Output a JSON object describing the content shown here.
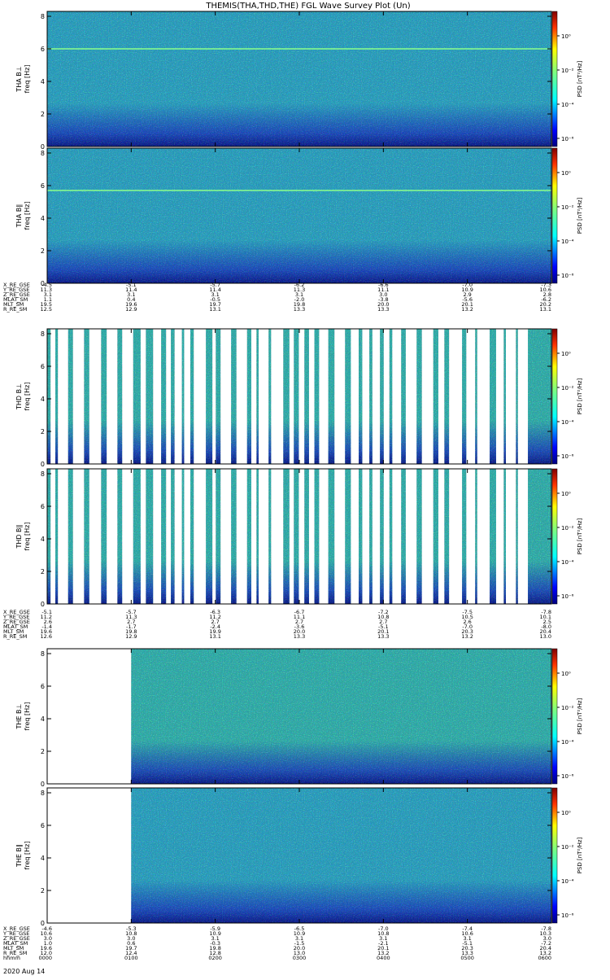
{
  "title": "THEMIS(THA,THD,THE) FGL Wave Survey Plot (Un)",
  "colorbar": {
    "tick_labels": [
      "10⁰",
      "10⁻²",
      "10⁻⁴",
      "10⁻⁶"
    ],
    "unit_label": "PSD [nT²/Hz]"
  },
  "chart_data": {
    "type": "heatmap",
    "x": {
      "tick_labels": [
        "0000",
        "0100",
        "0200",
        "0300",
        "0400",
        "0500",
        "0600"
      ],
      "unit": "hhmm",
      "date": "2020 Aug 14",
      "range_hours": [
        0,
        6
      ]
    },
    "y": {
      "label": "freq [Hz]",
      "ticks": [
        0,
        2,
        4,
        6,
        8
      ],
      "range": [
        0,
        8.3
      ]
    },
    "zscale": "log",
    "panels": [
      {
        "label": "THA B⊥",
        "coverage": [
          [
            0,
            6
          ]
        ],
        "line_hz": 6.0,
        "dominant": "mid"
      },
      {
        "label": "THA B∥",
        "coverage": [
          [
            0,
            6
          ]
        ],
        "line_hz": 5.7,
        "dominant": "mid"
      },
      {
        "label": "THD B⊥",
        "coverage": "intermittent",
        "dominant": "high"
      },
      {
        "label": "THD B∥",
        "coverage": "intermittent",
        "dominant": "high"
      },
      {
        "label": "THE B⊥",
        "coverage": [
          [
            1,
            6
          ]
        ],
        "dominant": "high"
      },
      {
        "label": "THE B∥",
        "coverage": [
          [
            1,
            6
          ]
        ],
        "dominant": "mid"
      }
    ],
    "ephemeris": [
      {
        "probe": "THA",
        "rows": [
          {
            "label": "X_RE_GSE",
            "values": [
              "-4.5",
              "-5.1",
              "-5.7",
              "-6.2",
              "-6.6",
              "-7.0",
              "-7.3"
            ]
          },
          {
            "label": "Y_RE_GSE",
            "values": [
              "11.3",
              "11.4",
              "11.4",
              "11.3",
              "11.1",
              "10.9",
              "10.6"
            ]
          },
          {
            "label": "Z_RE_GSE",
            "values": [
              "3.1",
              "3.1",
              "3.1",
              "3.1",
              "3.0",
              "2.9",
              "2.8"
            ]
          },
          {
            "label": "MLAT_SM",
            "values": [
              "1.1",
              "0.4",
              "-0.5",
              "-2.0",
              "-3.8",
              "-5.6",
              "-6.2"
            ]
          },
          {
            "label": "MLT_SM",
            "values": [
              "19.5",
              "19.6",
              "19.7",
              "19.8",
              "20.0",
              "20.1",
              "20.2"
            ]
          },
          {
            "label": "R_RE_SM",
            "values": [
              "12.5",
              "12.9",
              "13.1",
              "13.3",
              "13.3",
              "13.2",
              "13.1"
            ]
          }
        ]
      },
      {
        "probe": "THD",
        "rows": [
          {
            "label": "X_RE_GSE",
            "values": [
              "-5.1",
              "-5.7",
              "-6.3",
              "-6.7",
              "-7.2",
              "-7.5",
              "-7.8"
            ]
          },
          {
            "label": "Y_RE_GSE",
            "values": [
              "11.2",
              "11.3",
              "11.2",
              "11.1",
              "10.8",
              "10.5",
              "10.1"
            ]
          },
          {
            "label": "Z_RE_GSE",
            "values": [
              "2.6",
              "2.7",
              "2.7",
              "2.7",
              "2.7",
              "2.6",
              "2.5"
            ]
          },
          {
            "label": "MLAT_SM",
            "values": [
              "-1.4",
              "-1.7",
              "-2.4",
              "-3.6",
              "-5.1",
              "-7.0",
              "-8.0"
            ]
          },
          {
            "label": "MLT_SM",
            "values": [
              "19.6",
              "19.8",
              "19.9",
              "20.0",
              "20.1",
              "20.3",
              "20.4"
            ]
          },
          {
            "label": "R_RE_SM",
            "values": [
              "12.6",
              "12.9",
              "13.1",
              "13.3",
              "13.3",
              "13.2",
              "13.0"
            ]
          }
        ]
      },
      {
        "probe": "THE",
        "rows": [
          {
            "label": "X_RE_GSE",
            "values": [
              "-4.6",
              "-5.3",
              "-5.9",
              "-6.5",
              "-7.0",
              "-7.4",
              "-7.8"
            ]
          },
          {
            "label": "Y_RE_GSE",
            "values": [
              "10.6",
              "10.8",
              "10.9",
              "10.9",
              "10.8",
              "10.6",
              "10.3"
            ]
          },
          {
            "label": "Z_RE_GSE",
            "values": [
              "3.0",
              "3.0",
              "3.1",
              "3.1",
              "3.1",
              "3.1",
              "3.0"
            ]
          },
          {
            "label": "MLAT_SM",
            "values": [
              "1.0",
              "0.6",
              "-0.3",
              "-1.5",
              "-2.1",
              "-5.1",
              "-7.2"
            ]
          },
          {
            "label": "MLT_SM",
            "values": [
              "19.6",
              "19.7",
              "19.8",
              "20.0",
              "20.1",
              "20.3",
              "20.4"
            ]
          },
          {
            "label": "R_RE_SM",
            "values": [
              "12.0",
              "12.4",
              "12.8",
              "13.0",
              "13.2",
              "13.3",
              "13.2"
            ]
          },
          {
            "label": "hhmm",
            "values": [
              "0000",
              "0100",
              "0200",
              "0300",
              "0400",
              "0500",
              "0600"
            ]
          }
        ]
      }
    ]
  }
}
